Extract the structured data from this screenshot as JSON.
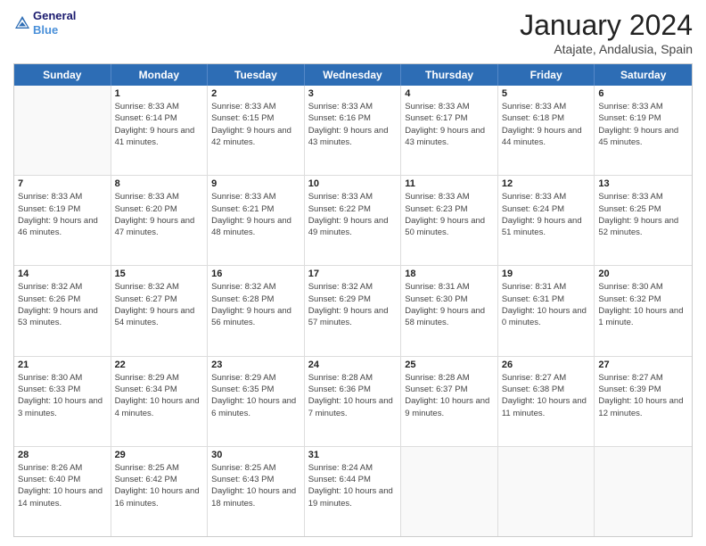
{
  "logo": {
    "line1": "General",
    "line2": "Blue"
  },
  "title": "January 2024",
  "subtitle": "Atajate, Andalusia, Spain",
  "header_days": [
    "Sunday",
    "Monday",
    "Tuesday",
    "Wednesday",
    "Thursday",
    "Friday",
    "Saturday"
  ],
  "weeks": [
    [
      {
        "day": "",
        "sunrise": "",
        "sunset": "",
        "daylight": ""
      },
      {
        "day": "1",
        "sunrise": "Sunrise: 8:33 AM",
        "sunset": "Sunset: 6:14 PM",
        "daylight": "Daylight: 9 hours and 41 minutes."
      },
      {
        "day": "2",
        "sunrise": "Sunrise: 8:33 AM",
        "sunset": "Sunset: 6:15 PM",
        "daylight": "Daylight: 9 hours and 42 minutes."
      },
      {
        "day": "3",
        "sunrise": "Sunrise: 8:33 AM",
        "sunset": "Sunset: 6:16 PM",
        "daylight": "Daylight: 9 hours and 43 minutes."
      },
      {
        "day": "4",
        "sunrise": "Sunrise: 8:33 AM",
        "sunset": "Sunset: 6:17 PM",
        "daylight": "Daylight: 9 hours and 43 minutes."
      },
      {
        "day": "5",
        "sunrise": "Sunrise: 8:33 AM",
        "sunset": "Sunset: 6:18 PM",
        "daylight": "Daylight: 9 hours and 44 minutes."
      },
      {
        "day": "6",
        "sunrise": "Sunrise: 8:33 AM",
        "sunset": "Sunset: 6:19 PM",
        "daylight": "Daylight: 9 hours and 45 minutes."
      }
    ],
    [
      {
        "day": "7",
        "sunrise": "Sunrise: 8:33 AM",
        "sunset": "Sunset: 6:19 PM",
        "daylight": "Daylight: 9 hours and 46 minutes."
      },
      {
        "day": "8",
        "sunrise": "Sunrise: 8:33 AM",
        "sunset": "Sunset: 6:20 PM",
        "daylight": "Daylight: 9 hours and 47 minutes."
      },
      {
        "day": "9",
        "sunrise": "Sunrise: 8:33 AM",
        "sunset": "Sunset: 6:21 PM",
        "daylight": "Daylight: 9 hours and 48 minutes."
      },
      {
        "day": "10",
        "sunrise": "Sunrise: 8:33 AM",
        "sunset": "Sunset: 6:22 PM",
        "daylight": "Daylight: 9 hours and 49 minutes."
      },
      {
        "day": "11",
        "sunrise": "Sunrise: 8:33 AM",
        "sunset": "Sunset: 6:23 PM",
        "daylight": "Daylight: 9 hours and 50 minutes."
      },
      {
        "day": "12",
        "sunrise": "Sunrise: 8:33 AM",
        "sunset": "Sunset: 6:24 PM",
        "daylight": "Daylight: 9 hours and 51 minutes."
      },
      {
        "day": "13",
        "sunrise": "Sunrise: 8:33 AM",
        "sunset": "Sunset: 6:25 PM",
        "daylight": "Daylight: 9 hours and 52 minutes."
      }
    ],
    [
      {
        "day": "14",
        "sunrise": "Sunrise: 8:32 AM",
        "sunset": "Sunset: 6:26 PM",
        "daylight": "Daylight: 9 hours and 53 minutes."
      },
      {
        "day": "15",
        "sunrise": "Sunrise: 8:32 AM",
        "sunset": "Sunset: 6:27 PM",
        "daylight": "Daylight: 9 hours and 54 minutes."
      },
      {
        "day": "16",
        "sunrise": "Sunrise: 8:32 AM",
        "sunset": "Sunset: 6:28 PM",
        "daylight": "Daylight: 9 hours and 56 minutes."
      },
      {
        "day": "17",
        "sunrise": "Sunrise: 8:32 AM",
        "sunset": "Sunset: 6:29 PM",
        "daylight": "Daylight: 9 hours and 57 minutes."
      },
      {
        "day": "18",
        "sunrise": "Sunrise: 8:31 AM",
        "sunset": "Sunset: 6:30 PM",
        "daylight": "Daylight: 9 hours and 58 minutes."
      },
      {
        "day": "19",
        "sunrise": "Sunrise: 8:31 AM",
        "sunset": "Sunset: 6:31 PM",
        "daylight": "Daylight: 10 hours and 0 minutes."
      },
      {
        "day": "20",
        "sunrise": "Sunrise: 8:30 AM",
        "sunset": "Sunset: 6:32 PM",
        "daylight": "Daylight: 10 hours and 1 minute."
      }
    ],
    [
      {
        "day": "21",
        "sunrise": "Sunrise: 8:30 AM",
        "sunset": "Sunset: 6:33 PM",
        "daylight": "Daylight: 10 hours and 3 minutes."
      },
      {
        "day": "22",
        "sunrise": "Sunrise: 8:29 AM",
        "sunset": "Sunset: 6:34 PM",
        "daylight": "Daylight: 10 hours and 4 minutes."
      },
      {
        "day": "23",
        "sunrise": "Sunrise: 8:29 AM",
        "sunset": "Sunset: 6:35 PM",
        "daylight": "Daylight: 10 hours and 6 minutes."
      },
      {
        "day": "24",
        "sunrise": "Sunrise: 8:28 AM",
        "sunset": "Sunset: 6:36 PM",
        "daylight": "Daylight: 10 hours and 7 minutes."
      },
      {
        "day": "25",
        "sunrise": "Sunrise: 8:28 AM",
        "sunset": "Sunset: 6:37 PM",
        "daylight": "Daylight: 10 hours and 9 minutes."
      },
      {
        "day": "26",
        "sunrise": "Sunrise: 8:27 AM",
        "sunset": "Sunset: 6:38 PM",
        "daylight": "Daylight: 10 hours and 11 minutes."
      },
      {
        "day": "27",
        "sunrise": "Sunrise: 8:27 AM",
        "sunset": "Sunset: 6:39 PM",
        "daylight": "Daylight: 10 hours and 12 minutes."
      }
    ],
    [
      {
        "day": "28",
        "sunrise": "Sunrise: 8:26 AM",
        "sunset": "Sunset: 6:40 PM",
        "daylight": "Daylight: 10 hours and 14 minutes."
      },
      {
        "day": "29",
        "sunrise": "Sunrise: 8:25 AM",
        "sunset": "Sunset: 6:42 PM",
        "daylight": "Daylight: 10 hours and 16 minutes."
      },
      {
        "day": "30",
        "sunrise": "Sunrise: 8:25 AM",
        "sunset": "Sunset: 6:43 PM",
        "daylight": "Daylight: 10 hours and 18 minutes."
      },
      {
        "day": "31",
        "sunrise": "Sunrise: 8:24 AM",
        "sunset": "Sunset: 6:44 PM",
        "daylight": "Daylight: 10 hours and 19 minutes."
      },
      {
        "day": "",
        "sunrise": "",
        "sunset": "",
        "daylight": ""
      },
      {
        "day": "",
        "sunrise": "",
        "sunset": "",
        "daylight": ""
      },
      {
        "day": "",
        "sunrise": "",
        "sunset": "",
        "daylight": ""
      }
    ]
  ]
}
